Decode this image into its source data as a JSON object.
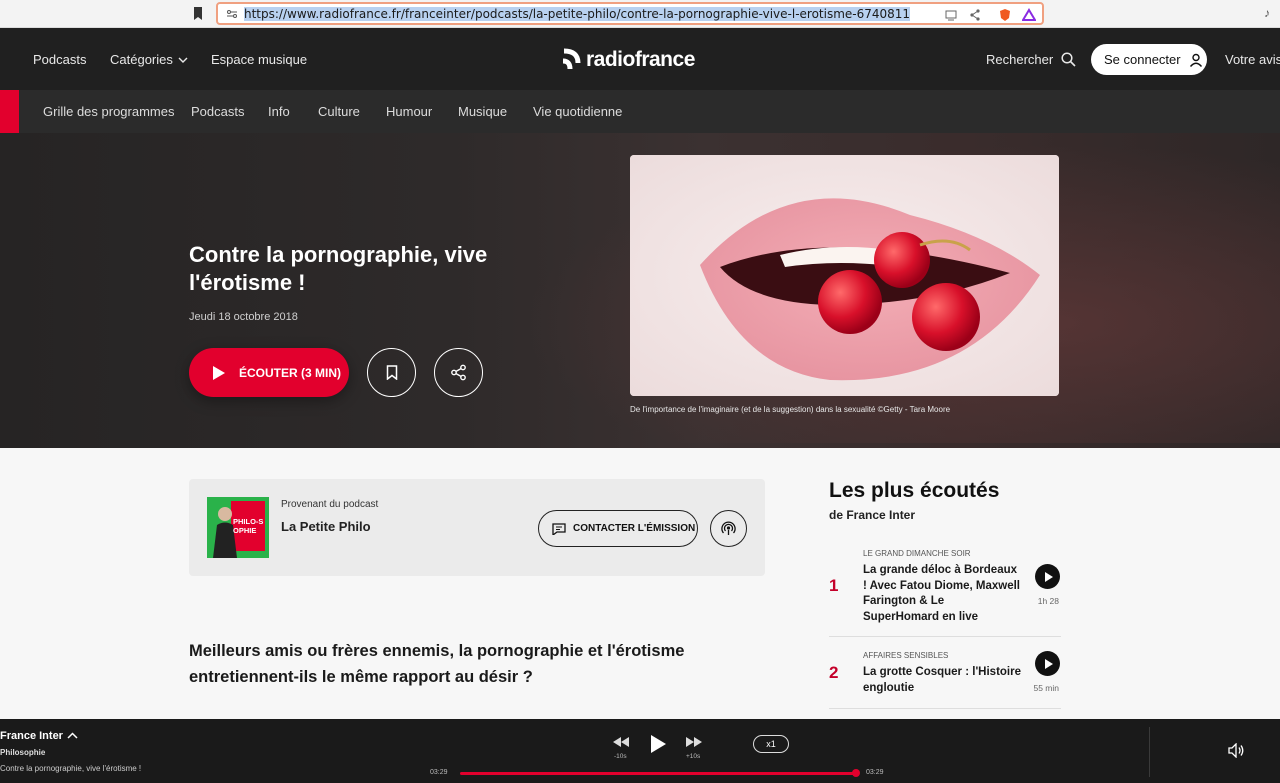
{
  "browser": {
    "url": "https://www.radiofrance.fr/franceinter/podcasts/la-petite-philo/contre-la-pornographie-vive-l-erotisme-6740811"
  },
  "header": {
    "nav": [
      "Podcasts",
      "Catégories",
      "Espace musique"
    ],
    "logo_text": "radiofrance",
    "search_label": "Rechercher",
    "connect_label": "Se connecter",
    "voice_label": "Votre avis"
  },
  "subnav": {
    "items": [
      "Grille des programmes",
      "Podcasts",
      "Info",
      "Culture",
      "Humour",
      "Musique",
      "Vie quotidienne"
    ]
  },
  "hero": {
    "title": "Contre la pornographie, vive l'érotisme !",
    "date": "Jeudi 18 octobre 2018",
    "listen_label": "ÉCOUTER (3 MIN)",
    "image_caption": "De l'importance de l'imaginaire (et de la suggestion) dans la sexualité ©Getty - Tara Moore"
  },
  "podcast": {
    "from_label": "Provenant du podcast",
    "name": "La Petite Philo",
    "thumb_text": "PHILO-SOPHIE",
    "contact_label": "CONTACTER L'ÉMISSION"
  },
  "article": {
    "lead": "Meilleurs amis ou frères ennemis, la pornographie et l'érotisme entretiennent-ils le même rapport au désir ?"
  },
  "sidebar": {
    "title": "Les plus écoutés",
    "subtitle": "de France Inter",
    "items": [
      {
        "rank": "1",
        "category": "LE GRAND DIMANCHE SOIR",
        "title": "La grande déloc à Bordeaux ! Avec Fatou Diome, Maxwell Farington & Le SuperHomard en live",
        "duration": "1h 28"
      },
      {
        "rank": "2",
        "category": "AFFAIRES SENSIBLES",
        "title": "La grotte Cosquer : l'Histoire engloutie",
        "duration": "55 min"
      }
    ]
  },
  "player": {
    "station": "France Inter",
    "show": "Philosophie",
    "episode": "Contre la pornographie, vive l'érotisme !",
    "rewind_label": "-10s",
    "forward_label": "+10s",
    "speed": "x1",
    "time_current": "03:29",
    "time_total": "03:29",
    "progress_pct": 100
  },
  "colors": {
    "accent": "#e2002d",
    "header_bg": "#202020",
    "player_bg": "#1a1a1a"
  }
}
